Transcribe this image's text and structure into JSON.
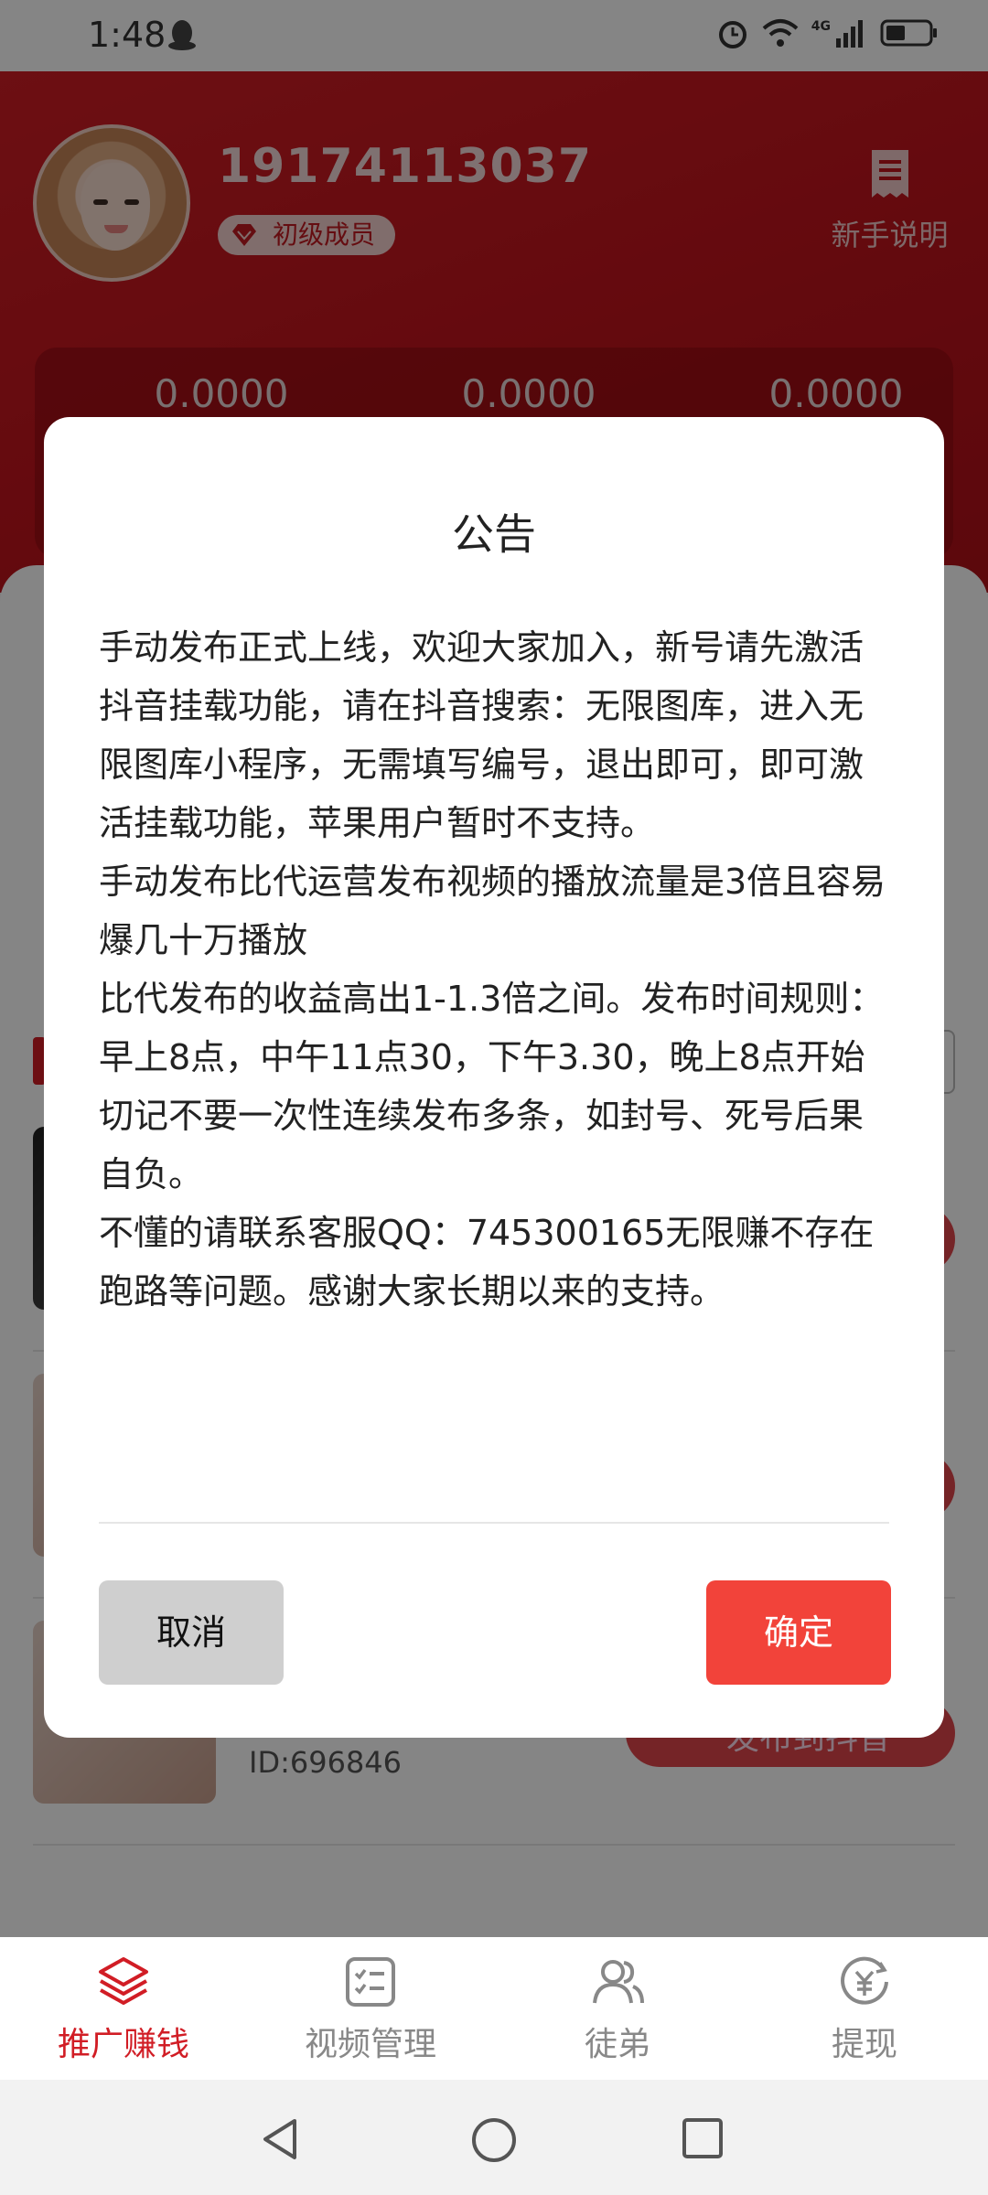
{
  "status_bar": {
    "time": "1:48",
    "network_label": "4G",
    "icons": [
      "qq-penguin-icon",
      "alarm-icon",
      "wifi-icon",
      "signal-icon",
      "battery-icon"
    ]
  },
  "header": {
    "phone": "19174113037",
    "member_badge": "初级成员",
    "guide_label": "新手说明",
    "stats": [
      "0.0000",
      "0.0000",
      "0.0000"
    ]
  },
  "list": {
    "items": [
      {
        "id_text": "",
        "button": ""
      },
      {
        "id_text": "",
        "button": ""
      },
      {
        "id_text": "ID:696846",
        "button": "发布到抖音"
      }
    ]
  },
  "modal": {
    "title": "公告",
    "paragraphs": [
      "手动发布正式上线，欢迎大家加入，新号请先激活抖音挂载功能，请在抖音搜索：无限图库，进入无限图库小程序，无需填写编号，退出即可，即可激活挂载功能，苹果用户暂时不支持。",
      "手动发布比代运营发布视频的播放流量是3倍且容易爆几十万播放",
      "比代发布的收益高出1-1.3倍之间。发布时间规则：早上8点，中午11点30，下午3.30，晚上8点开始",
      "切记不要一次性连续发布多条，如封号、死号后果自负。",
      "不懂的请联系客服QQ：745300165无限赚不存在跑路等问题。感谢大家长期以来的支持。"
    ],
    "cancel_label": "取消",
    "confirm_label": "确定"
  },
  "bottom_nav": [
    {
      "label": "推广赚钱",
      "icon": "layers-icon",
      "active": true
    },
    {
      "label": "视频管理",
      "icon": "checklist-icon",
      "active": false
    },
    {
      "label": "徒弟",
      "icon": "users-icon",
      "active": false
    },
    {
      "label": "提现",
      "icon": "yuan-coin-icon",
      "active": false
    }
  ],
  "colors": {
    "brand_red": "#d11d25",
    "confirm_red": "#f2433a",
    "cancel_gray": "#cfcfcf"
  }
}
